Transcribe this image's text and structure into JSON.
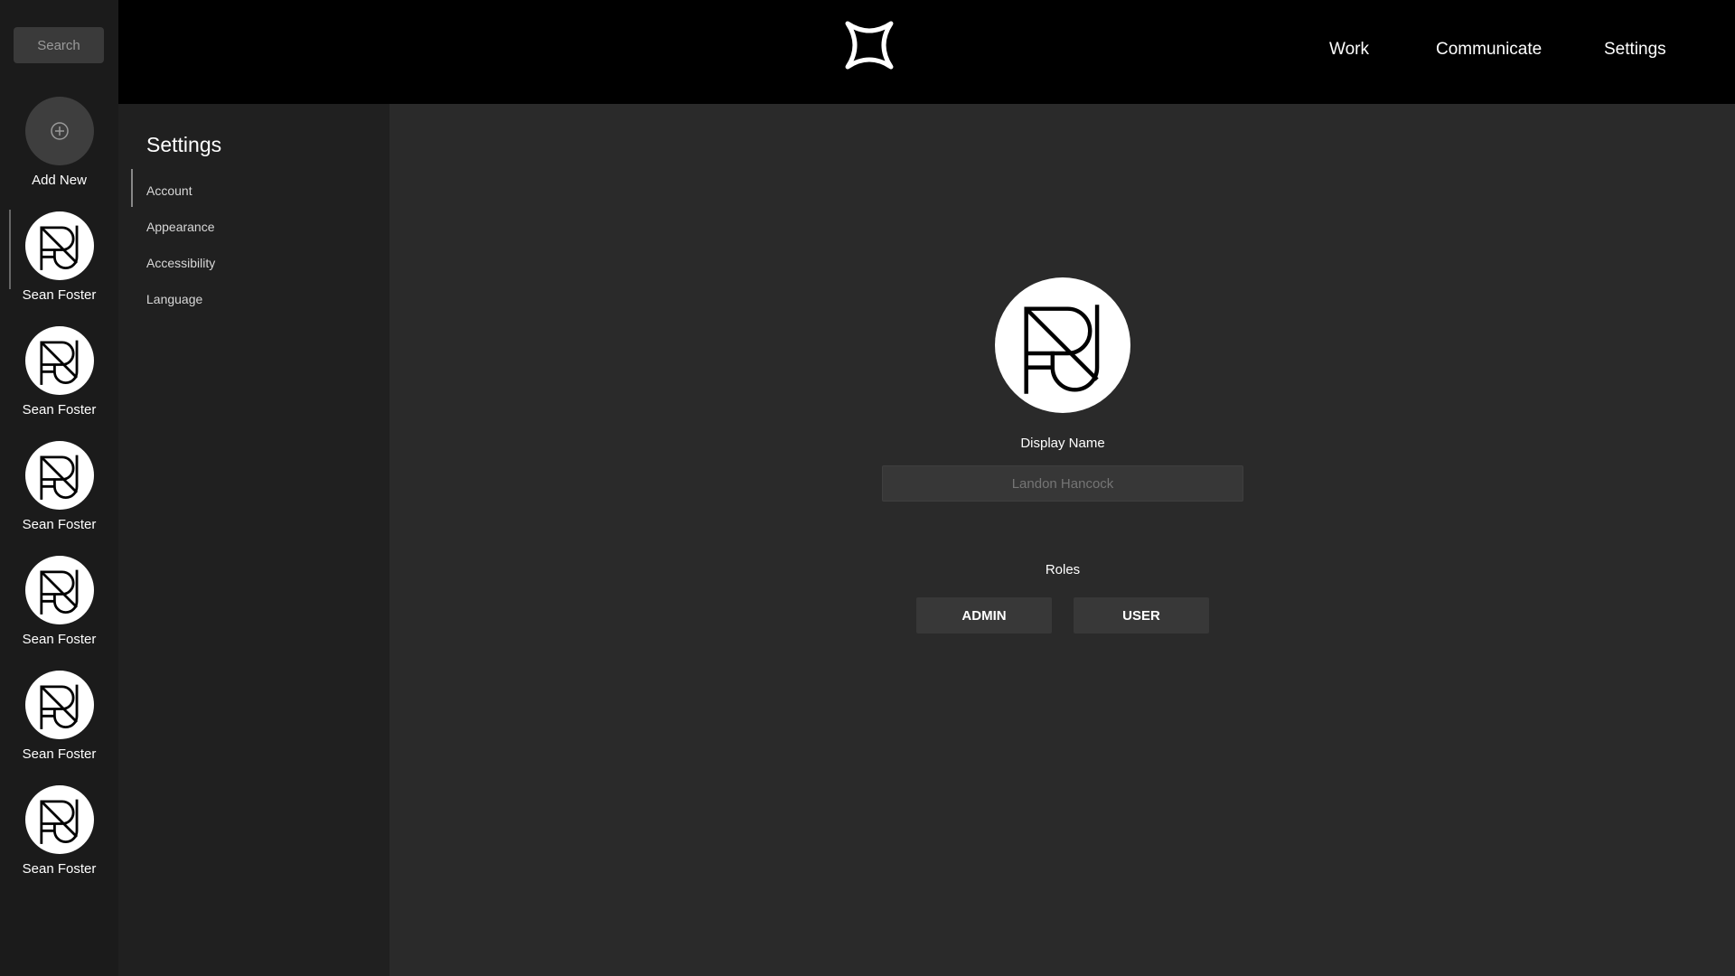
{
  "search": {
    "label": "Search"
  },
  "add_new": {
    "label": "Add New",
    "icon": "plus-circle-icon"
  },
  "rail_users": [
    {
      "name": "Sean Foster"
    },
    {
      "name": "Sean Foster"
    },
    {
      "name": "Sean Foster"
    },
    {
      "name": "Sean Foster"
    },
    {
      "name": "Sean Foster"
    },
    {
      "name": "Sean Foster"
    }
  ],
  "topnav": {
    "logo": "sparkle-logo",
    "links": [
      "Work",
      "Communicate",
      "Settings"
    ]
  },
  "settings": {
    "title": "Settings",
    "items": [
      "Account",
      "Appearance",
      "Accessibility",
      "Language"
    ],
    "active": "Account"
  },
  "profile": {
    "display_name_label": "Display Name",
    "display_name_placeholder": "Landon Hancock",
    "roles_label": "Roles",
    "roles": [
      "ADMIN",
      "USER"
    ]
  },
  "colors": {
    "rail_bg": "#1b1b1b",
    "topbar_bg": "#000000",
    "sidebar_bg": "#202020",
    "main_bg": "#2a2a2a"
  }
}
